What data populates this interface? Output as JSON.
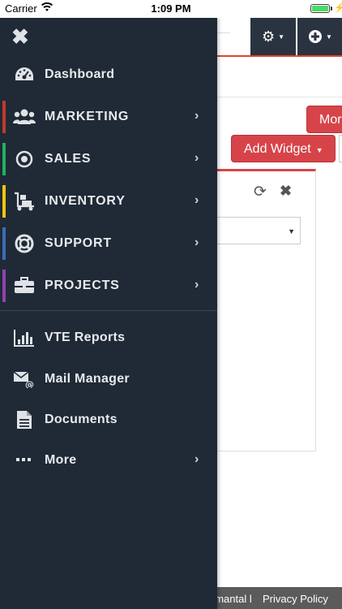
{
  "status_bar": {
    "carrier": "Carrier",
    "time": "1:09 PM",
    "battery_level": 1.0
  },
  "header": {
    "settings_icon": "gear-icon",
    "add_icon": "plus-circle-icon"
  },
  "toolbar": {
    "more_label": "More",
    "add_widget_label": "Add Widget"
  },
  "widget": {
    "refresh_icon": "refresh-icon",
    "close_icon": "close-icon"
  },
  "footer": {
    "left_text": "umantal l",
    "right_text": "Privacy Policy"
  },
  "drawer": {
    "close_icon": "close-icon",
    "items": [
      {
        "label": "Dashboard",
        "icon": "dashboard-icon",
        "has_submenu": false
      },
      {
        "label": "MARKETING",
        "icon": "users-icon",
        "accent": "#c0392b",
        "has_submenu": true
      },
      {
        "label": "SALES",
        "icon": "target-icon",
        "accent": "#27ae60",
        "has_submenu": true
      },
      {
        "label": "INVENTORY",
        "icon": "dolly-icon",
        "accent": "#f1c40f",
        "has_submenu": true
      },
      {
        "label": "SUPPORT",
        "icon": "lifebuoy-icon",
        "accent": "#3b6eb5",
        "has_submenu": true
      },
      {
        "label": "PROJECTS",
        "icon": "briefcase-icon",
        "accent": "#8e44ad",
        "has_submenu": true
      },
      {
        "label": "VTE Reports",
        "icon": "bar-chart-icon",
        "has_submenu": false
      },
      {
        "label": "Mail Manager",
        "icon": "mail-icon",
        "has_submenu": false
      },
      {
        "label": "Documents",
        "icon": "document-icon",
        "has_submenu": false
      },
      {
        "label": "More",
        "icon": "ellipsis-icon",
        "has_submenu": true
      }
    ]
  },
  "colors": {
    "drawer_bg": "#1f2a36",
    "accent_red": "#d64449",
    "header_dark": "#2a3440"
  }
}
